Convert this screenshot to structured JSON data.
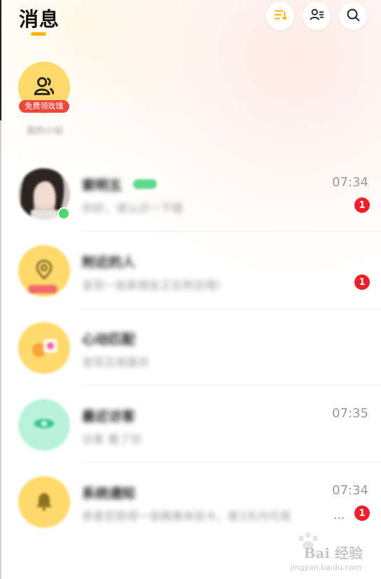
{
  "header": {
    "title": "消息",
    "icons": [
      "sort-icon",
      "contacts-icon",
      "search-icon"
    ]
  },
  "friends_entry": {
    "badge": "免费领玫瑰",
    "label": "我的小站"
  },
  "conversations": [
    {
      "name": "索明五",
      "preview": "你好，请认识一下哦",
      "time": "07:34",
      "unread": "1",
      "avatar": "user-photo"
    },
    {
      "name": "附近的人",
      "preview": "发现一批新朋友正在附近哦！",
      "time": "",
      "unread": "1",
      "avatar": "location-icon"
    },
    {
      "name": "心动匹配",
      "preview": "发现互相喜欢",
      "time": "",
      "unread": "",
      "avatar": "heart-match-icon"
    },
    {
      "name": "最近访客",
      "preview": "访客 看了你",
      "time": "07:35",
      "unread": "",
      "avatar": "eye-icon"
    },
    {
      "name": "系统通知",
      "preview": "恭喜您获得一张精美体验卡，第3天内可用",
      "time": "07:34",
      "unread": "1",
      "avatar": "bell-icon"
    }
  ],
  "watermark": {
    "brand": "Bai 经验",
    "url": "jingyan.baidu.com"
  },
  "colors": {
    "accent": "#ffb400",
    "badge_red": "#f01f2a",
    "friend_yellow": "#ffd96a",
    "visitor_green": "#b8f2dc"
  }
}
